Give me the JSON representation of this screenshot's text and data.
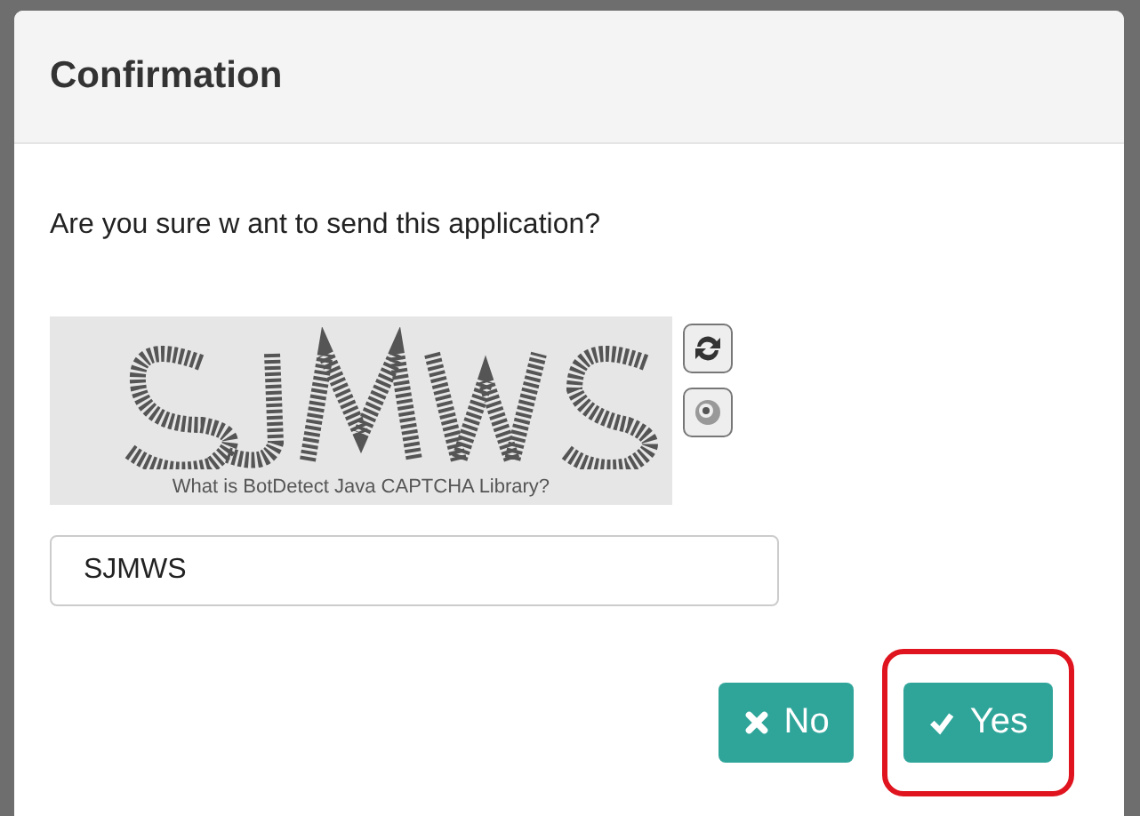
{
  "dialog": {
    "title": "Confirmation",
    "message": "Are you sure w ant to send this application?",
    "captcha": {
      "caption": "What is BotDetect Java CAPTCHA Library?"
    },
    "code_field": {
      "value": "SJMWS"
    },
    "buttons": [
      {
        "kind": "cancel",
        "label": "No",
        "highlighted": false
      },
      {
        "kind": "confirm",
        "label": "Yes",
        "highlighted": true
      }
    ]
  }
}
